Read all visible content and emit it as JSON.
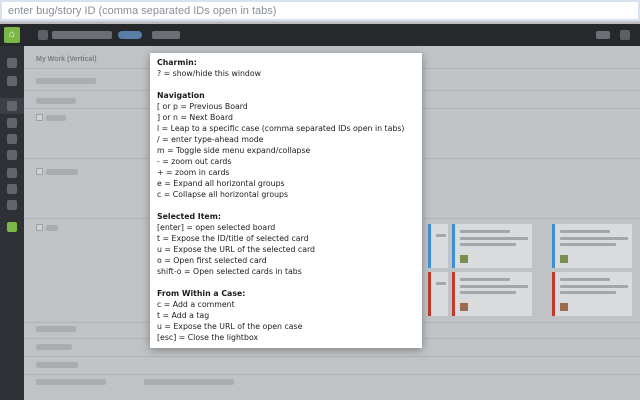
{
  "search": {
    "placeholder": "enter bug/story ID (comma separated IDs open in tabs)"
  },
  "colors": {
    "toolbar_bg": "#26282b",
    "accent_green": "#7ab648",
    "card_blue": "#3f8fd6",
    "card_red": "#c0392b",
    "overlay_bg": "#ffffff"
  },
  "toolbar": {
    "home_icon": "home-icon"
  },
  "board": {
    "title": "My Work (Vertical)"
  },
  "help": {
    "title": "Charmin:",
    "intro": "? = show/hide this window",
    "sections": [
      {
        "heading": "Navigation",
        "items": [
          "[ or p = Previous Board",
          "] or n = Next Board",
          "l = Leap to a specific case (comma separated IDs open in tabs)",
          "/ = enter type-ahead mode",
          "m = Toggle side menu expand/collapse",
          "- = zoom out cards",
          "+ = zoom in cards",
          "e = Expand all horizontal groups",
          "c = Collapse all horizontal groups"
        ]
      },
      {
        "heading": "Selected Item:",
        "items": [
          "[enter] = open selected board",
          "t = Expose the ID/title of selected card",
          "u = Expose the URL of the selected card",
          "o = Open first selected card",
          "shift-o = Open selected cards in tabs"
        ]
      },
      {
        "heading": "From Within a Case:",
        "items": [
          "c = Add a comment",
          "t = Add a tag",
          "u = Expose the URL of the open case",
          "[esc] = Close the lightbox"
        ]
      }
    ]
  }
}
